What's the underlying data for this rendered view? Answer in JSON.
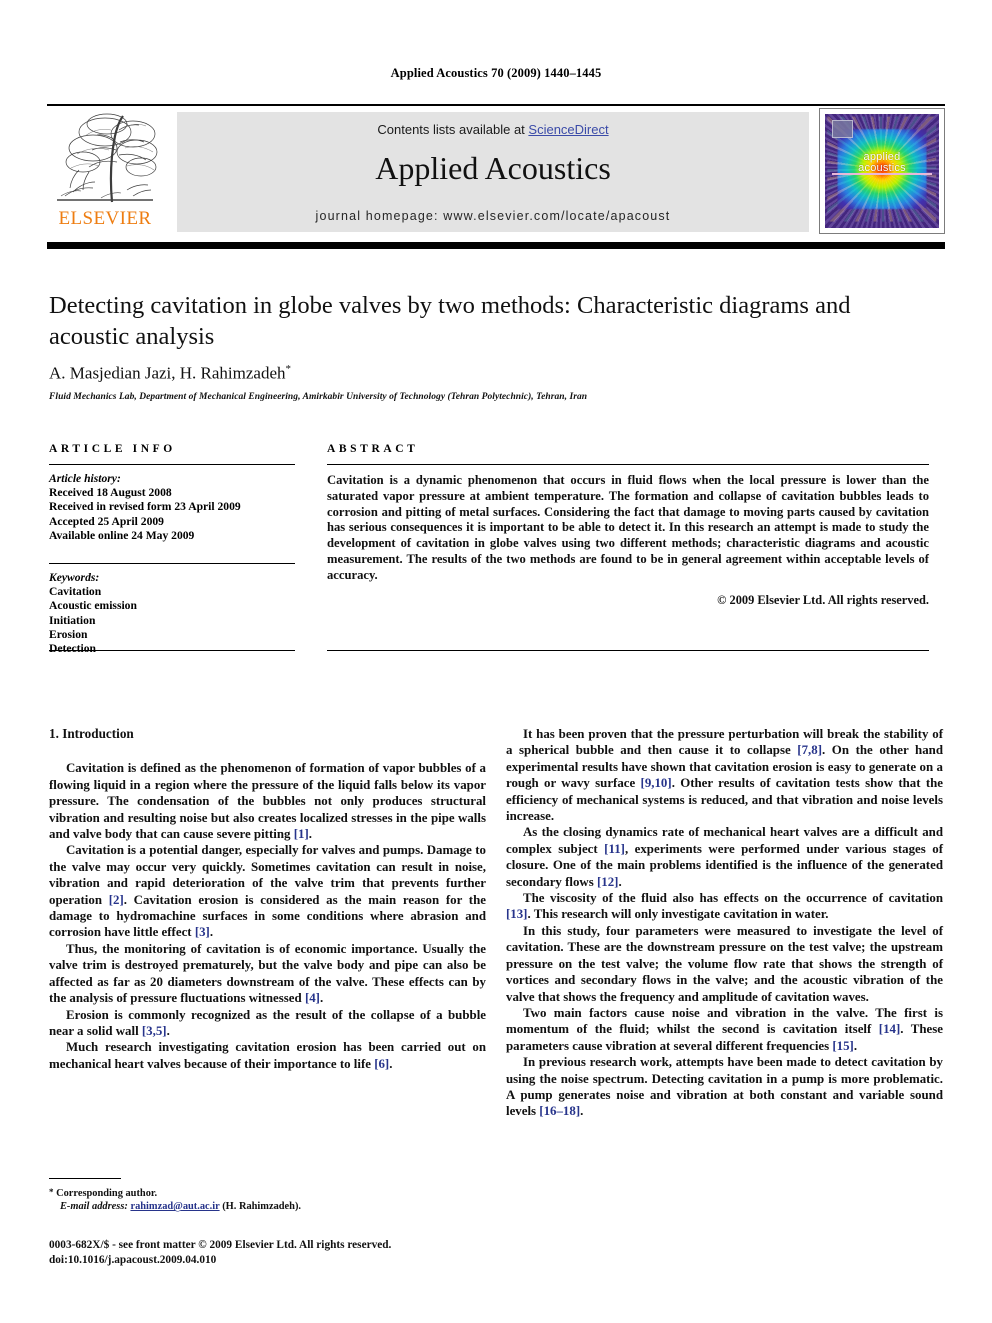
{
  "running_head": "Applied Acoustics 70 (2009) 1440–1445",
  "masthead": {
    "publisher_wordmark": "ELSEVIER",
    "contents_prefix": "Contents lists available at ",
    "contents_link": "ScienceDirect",
    "journal_title": "Applied Acoustics",
    "homepage": "journal homepage: www.elsevier.com/locate/apacoust",
    "cover_line1": "applied",
    "cover_line2": "acoustics",
    "link_color": "#3b4ba8",
    "elsevier_orange": "#ee7d11",
    "banner_bg": "#e3e3e3"
  },
  "article": {
    "title": "Detecting cavitation in globe valves by two methods: Characteristic diagrams and acoustic analysis",
    "authors": "A. Masjedian Jazi, H. Rahimzadeh",
    "author_marker": "*",
    "affiliation": "Fluid Mechanics Lab, Department of Mechanical Engineering, Amirkabir University of Technology (Tehran Polytechnic), Tehran, Iran"
  },
  "info": {
    "heading": "ARTICLE INFO",
    "history_label": "Article history:",
    "history": [
      "Received 18 August 2008",
      "Received in revised form 23 April 2009",
      "Accepted 25 April 2009",
      "Available online 24 May 2009"
    ],
    "keywords_label": "Keywords:",
    "keywords": [
      "Cavitation",
      "Acoustic emission",
      "Initiation",
      "Erosion",
      "Detection"
    ]
  },
  "abstract": {
    "heading": "ABSTRACT",
    "text": "Cavitation is a dynamic phenomenon that occurs in fluid flows when the local pressure is lower than the saturated vapor pressure at ambient temperature. The formation and collapse of cavitation bubbles leads to corrosion and pitting of metal surfaces. Considering the fact that damage to moving parts caused by cavitation has serious consequences it is important to be able to detect it. In this research an attempt is made to study the development of cavitation in globe valves using two different methods; characteristic diagrams and acoustic measurement. The results of the two methods are found to be in general agreement within acceptable levels of accuracy.",
    "copyright": "© 2009 Elsevier Ltd. All rights reserved."
  },
  "body": {
    "section_title": "1. Introduction",
    "left_paragraphs": [
      "Cavitation is defined as the phenomenon of formation of vapor bubbles of a flowing liquid in a region where the pressure of the liquid falls below its vapor pressure. The condensation of the bubbles not only produces structural vibration and resulting noise but also creates localized stresses in the pipe walls and valve body that can cause severe pitting [1].",
      "Cavitation is a potential danger, especially for valves and pumps. Damage to the valve may occur very quickly. Sometimes cavitation can result in noise, vibration and rapid deterioration of the valve trim that prevents further operation [2]. Cavitation erosion is considered as the main reason for the damage to hydromachine surfaces in some conditions where abrasion and corrosion have little effect [3].",
      "Thus, the monitoring of cavitation is of economic importance. Usually the valve trim is destroyed prematurely, but the valve body and pipe can also be affected as far as 20 diameters downstream of the valve. These effects can by the analysis of pressure fluctuations witnessed [4].",
      "Erosion is commonly recognized as the result of the collapse of a bubble near a solid wall [3,5].",
      "Much research investigating cavitation erosion has been carried out on mechanical heart valves because of their importance to life [6]."
    ],
    "right_paragraphs": [
      "It has been proven that the pressure perturbation will break the stability of a spherical bubble and then cause it to collapse [7,8]. On the other hand experimental results have shown that cavitation erosion is easy to generate on a rough or wavy surface [9,10]. Other results of cavitation tests show that the efficiency of mechanical systems is reduced, and that vibration and noise levels increase.",
      "As the closing dynamics rate of mechanical heart valves are a difficult and complex subject [11], experiments were performed under various stages of closure. One of the main problems identified is the influence of the generated secondary flows [12].",
      "The viscosity of the fluid also has effects on the occurrence of cavitation [13]. This research will only investigate cavitation in water.",
      "In this study, four parameters were measured to investigate the level of cavitation. These are the downstream pressure on the test valve; the upstream pressure on the test valve; the volume flow rate that shows the strength of vortices and secondary flows in the valve; and the acoustic vibration of the valve that shows the frequency and amplitude of cavitation waves.",
      "Two main factors cause noise and vibration in the valve. The first is momentum of the fluid; whilst the second is cavitation itself [14]. These parameters cause vibration at several different frequencies [15].",
      "In previous research work, attempts have been made to detect cavitation by using the noise spectrum. Detecting cavitation in a pump is more problematic. A pump generates noise and vibration at both constant and variable sound levels [16–18]."
    ]
  },
  "footnote": {
    "marker": "*",
    "corresponding": "Corresponding author.",
    "email_label": "E-mail address:",
    "email": "rahimzad@aut.ac.ir",
    "email_owner": "(H. Rahimzadeh)."
  },
  "page_footer": {
    "line1": "0003-682X/$ - see front matter © 2009 Elsevier Ltd. All rights reserved.",
    "line2": "doi:10.1016/j.apacoust.2009.04.010"
  }
}
